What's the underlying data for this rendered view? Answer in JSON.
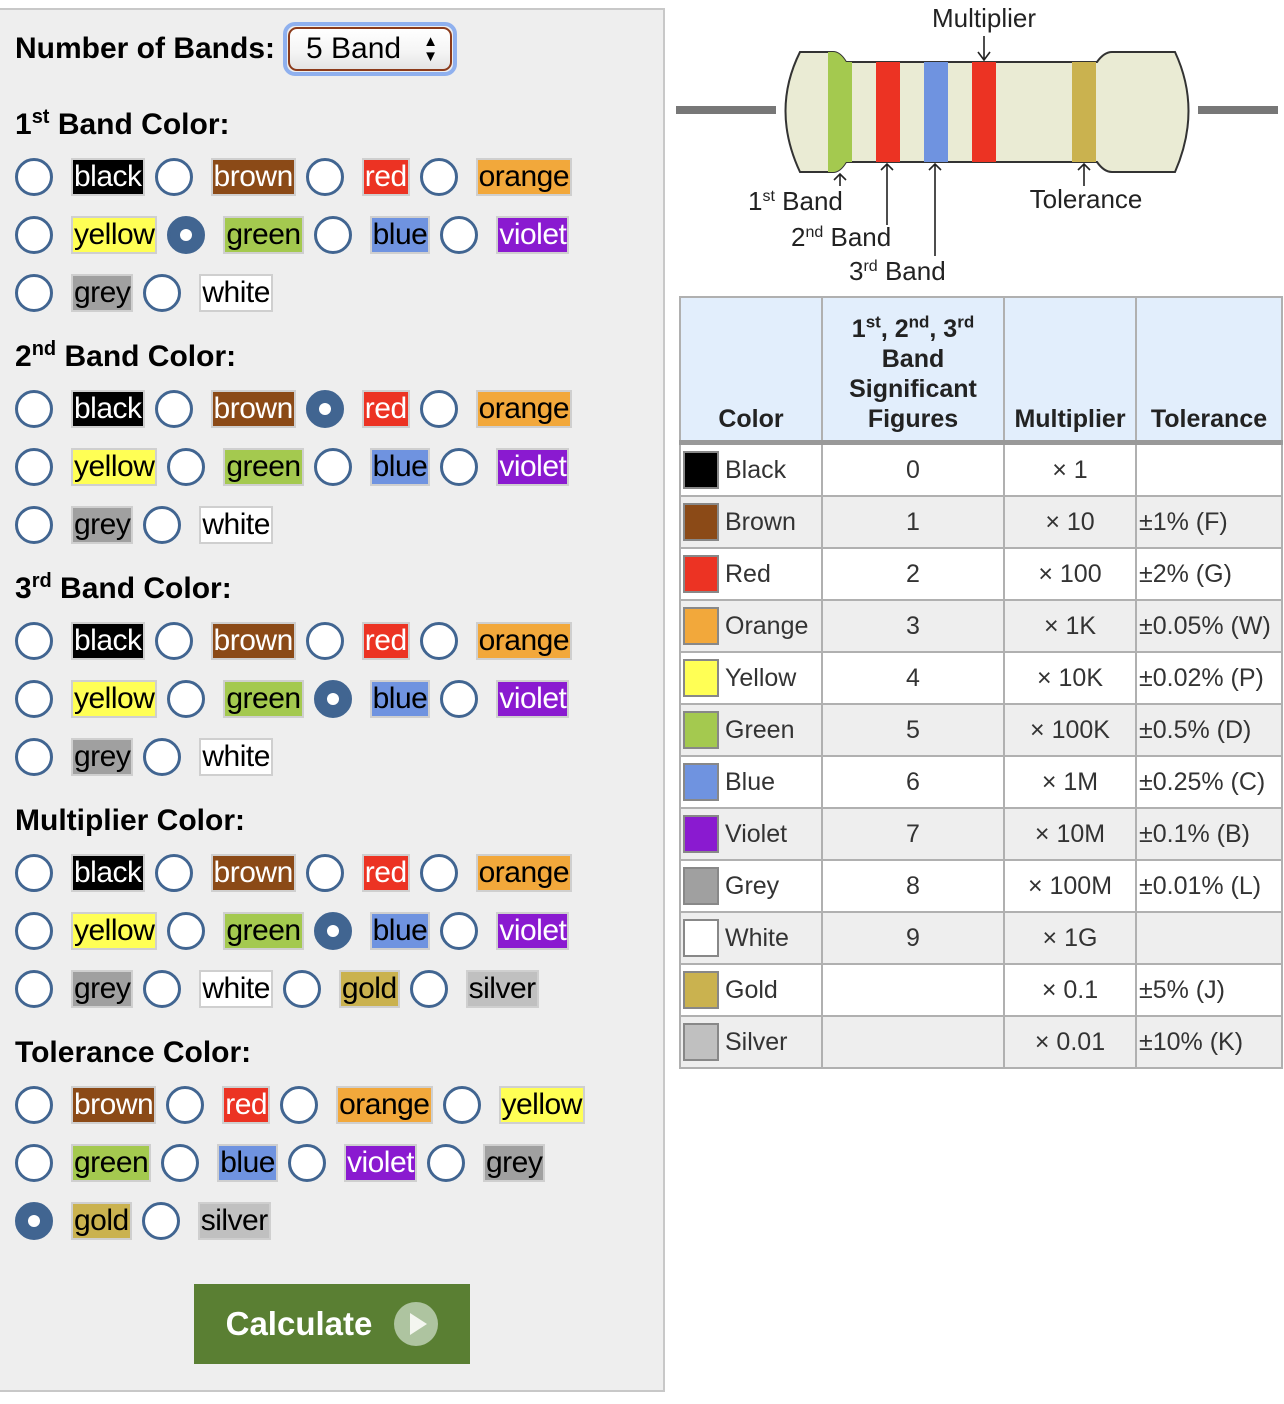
{
  "bands_selector": {
    "label": "Number of Bands:",
    "value": "5 Band"
  },
  "colors": {
    "black": "#000000",
    "brown": "#8b4a17",
    "red": "#ec3323",
    "orange": "#f2a83b",
    "yellow": "#ffff55",
    "green": "#a4c94f",
    "blue": "#6f93e0",
    "violet": "#8a1ad0",
    "grey": "#a0a0a0",
    "white": "#ffffff",
    "gold": "#cab24f",
    "silver": "#c0c0c0",
    "radio": "#416591",
    "button": "#5a7f33",
    "table_header": "#e2eefc"
  },
  "groups": [
    {
      "num": "1",
      "sup": "st",
      "title": "Band Color:",
      "rows": [
        [
          "black",
          "brown",
          "red",
          "orange"
        ],
        [
          "yellow",
          "green",
          "blue",
          "violet"
        ],
        [
          "grey",
          "white"
        ]
      ],
      "selected": "green"
    },
    {
      "num": "2",
      "sup": "nd",
      "title": "Band Color:",
      "rows": [
        [
          "black",
          "brown",
          "red",
          "orange"
        ],
        [
          "yellow",
          "green",
          "blue",
          "violet"
        ],
        [
          "grey",
          "white"
        ]
      ],
      "selected": "red"
    },
    {
      "num": "3",
      "sup": "rd",
      "title": "Band Color:",
      "rows": [
        [
          "black",
          "brown",
          "red",
          "orange"
        ],
        [
          "yellow",
          "green",
          "blue",
          "violet"
        ],
        [
          "grey",
          "white"
        ]
      ],
      "selected": "blue"
    },
    {
      "num": "",
      "sup": "",
      "title": "Multiplier Color:",
      "rows": [
        [
          "black",
          "brown",
          "red",
          "orange"
        ],
        [
          "yellow",
          "green",
          "blue",
          "violet"
        ],
        [
          "grey",
          "white",
          "gold",
          "silver"
        ]
      ],
      "selected": "blue"
    },
    {
      "num": "",
      "sup": "",
      "title": "Tolerance Color:",
      "rows": [
        [
          "brown",
          "red",
          "orange",
          "yellow"
        ],
        [
          "green",
          "blue",
          "violet",
          "grey"
        ],
        [
          "gold",
          "silver"
        ]
      ],
      "selected": "gold"
    }
  ],
  "calculate_label": "Calculate",
  "diagram": {
    "multiplier": "Multiplier",
    "tolerance": "Tolerance",
    "band1": {
      "num": "1",
      "sup": "st",
      "word": "Band"
    },
    "band2": {
      "num": "2",
      "sup": "nd",
      "word": "Band"
    },
    "band3": {
      "num": "3",
      "sup": "rd",
      "word": "Band"
    },
    "band_colors": [
      "green",
      "red",
      "blue",
      "red",
      "gold"
    ]
  },
  "table": {
    "headers": {
      "color": "Color",
      "sig_line1": [
        "1",
        "st",
        ", 2",
        "nd",
        ", 3",
        "rd"
      ],
      "sig_rest": "Band Significant Figures",
      "multiplier": "Multiplier",
      "tolerance": "Tolerance"
    },
    "rows": [
      {
        "name": "Black",
        "key": "black",
        "fig": "0",
        "mult": "× 1",
        "tol": ""
      },
      {
        "name": "Brown",
        "key": "brown",
        "fig": "1",
        "mult": "× 10",
        "tol": "±1% (F)"
      },
      {
        "name": "Red",
        "key": "red",
        "fig": "2",
        "mult": "× 100",
        "tol": "±2% (G)"
      },
      {
        "name": "Orange",
        "key": "orange",
        "fig": "3",
        "mult": "× 1K",
        "tol": "±0.05% (W)"
      },
      {
        "name": "Yellow",
        "key": "yellow",
        "fig": "4",
        "mult": "× 10K",
        "tol": "±0.02% (P)"
      },
      {
        "name": "Green",
        "key": "green",
        "fig": "5",
        "mult": "× 100K",
        "tol": "±0.5% (D)"
      },
      {
        "name": "Blue",
        "key": "blue",
        "fig": "6",
        "mult": "× 1M",
        "tol": "±0.25% (C)"
      },
      {
        "name": "Violet",
        "key": "violet",
        "fig": "7",
        "mult": "× 10M",
        "tol": "±0.1% (B)"
      },
      {
        "name": "Grey",
        "key": "grey",
        "fig": "8",
        "mult": "× 100M",
        "tol": "±0.01% (L)"
      },
      {
        "name": "White",
        "key": "white",
        "fig": "9",
        "mult": "× 1G",
        "tol": ""
      },
      {
        "name": "Gold",
        "key": "gold",
        "fig": "",
        "mult": "× 0.1",
        "tol": "±5% (J)"
      },
      {
        "name": "Silver",
        "key": "silver",
        "fig": "",
        "mult": "× 0.01",
        "tol": "±10% (K)"
      }
    ]
  }
}
